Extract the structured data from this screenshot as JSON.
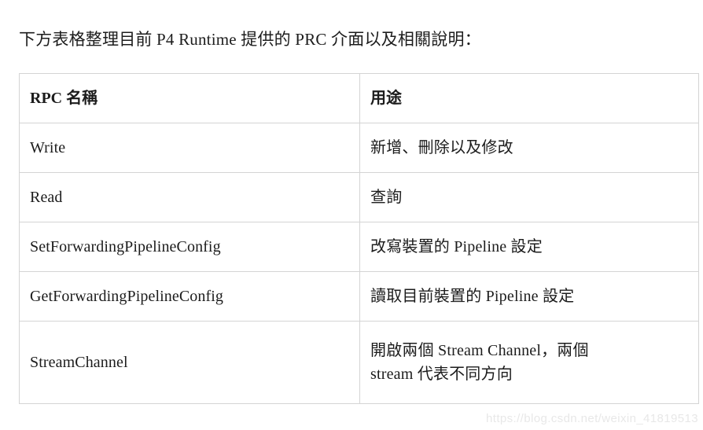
{
  "document": {
    "intro_paragraph": "下方表格整理目前 P4 Runtime 提供的 PRC 介面以及相關說明：",
    "watermark": "https://blog.csdn.net/weixin_41819513",
    "background_color": "#ffffff",
    "text_color": "#1c1c1c",
    "border_color": "#d4d4d4",
    "watermark_color": "#e8e8e8"
  },
  "table": {
    "columns": [
      {
        "header": "RPC 名稱"
      },
      {
        "header": "用途"
      }
    ],
    "rows": [
      {
        "name": "Write",
        "purpose_line1": "新增、刪除以及修改",
        "purpose_line2": ""
      },
      {
        "name": "Read",
        "purpose_line1": "查詢",
        "purpose_line2": ""
      },
      {
        "name": "SetForwardingPipelineConfig",
        "purpose_line1": "改寫裝置的 Pipeline 設定",
        "purpose_line2": ""
      },
      {
        "name": "GetForwardingPipelineConfig",
        "purpose_line1": "讀取目前裝置的 Pipeline 設定",
        "purpose_line2": ""
      },
      {
        "name": "StreamChannel",
        "purpose_line1": "開啟兩個 Stream Channel，兩個",
        "purpose_line2": "stream 代表不同方向"
      }
    ]
  }
}
